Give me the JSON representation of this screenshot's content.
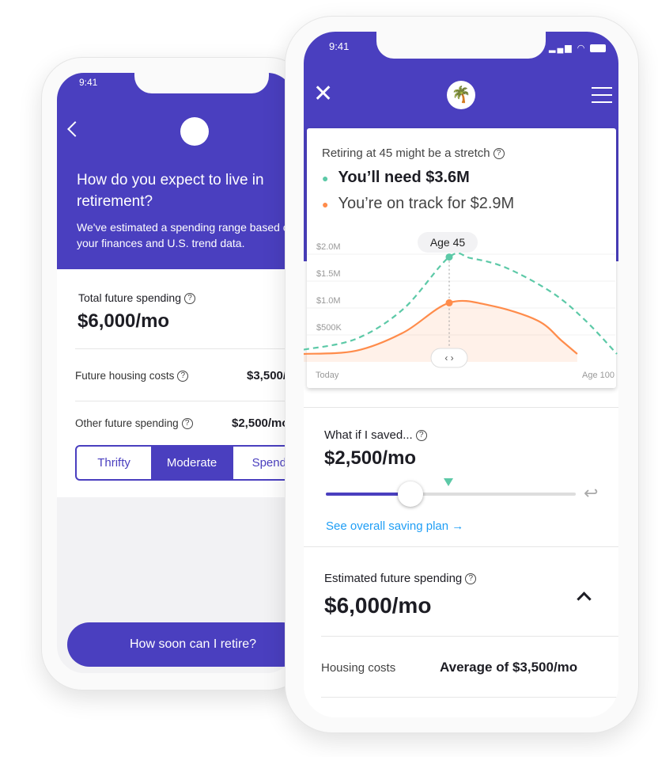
{
  "colors": {
    "brand": "#4a3fbf",
    "need": "#5cc9a7",
    "on_track": "#ff8c4b",
    "link": "#1f9ef5"
  },
  "back_phone": {
    "status_time": "9:41",
    "back_icon": "chevron-left-icon",
    "title": "How do you expect to live in retirement?",
    "subtitle": "We've estimated a spending range based on your finances and U.S. trend data.",
    "total_label": "Total future spending",
    "total_value": "$6,000/mo",
    "housing_label": "Future housing costs",
    "housing_value": "$3,500/mo",
    "other_label": "Other future spending",
    "other_value": "$2,500/mo",
    "segments": [
      "Thrifty",
      "Moderate",
      "Spendy"
    ],
    "selected_segment": "Moderate",
    "cta": "How soon can I retire?"
  },
  "front_phone": {
    "status_time": "9:41",
    "close_icon": "close-icon",
    "logo_icon": "palm-tree-icon",
    "menu_icon": "hamburger-menu-icon",
    "card": {
      "headline": "Retiring at 45 might be a stretch",
      "need": "You’ll need $3.6M",
      "on_track": "You’re on track for $2.9M"
    },
    "saving": {
      "label": "What if I saved...",
      "value": "$2,500/mo",
      "slider_fraction": 0.34,
      "target_fraction": 0.49,
      "link": "See overall saving plan →"
    },
    "spending": {
      "label": "Estimated future spending",
      "value": "$6,000/mo",
      "housing_label": "Housing costs",
      "housing_value": "Average of $3,500/mo"
    }
  },
  "chart_data": {
    "type": "line",
    "tooltip": "Age 45",
    "x_labels": [
      "Today",
      "Age 100"
    ],
    "y_ticks": [
      "$500K",
      "$1.0M",
      "$1.5M",
      "$2.0M"
    ],
    "y_tick_values": [
      0.5,
      1.0,
      1.5,
      2.0
    ],
    "ylim": [
      0,
      2.0
    ],
    "x_unit": "age",
    "y_unit": "$M",
    "marker_x": 45,
    "series": [
      {
        "key": "need",
        "style": "dashed",
        "points": [
          [
            30,
            0.08
          ],
          [
            35.4,
            0.28
          ],
          [
            40.3,
            0.84
          ],
          [
            45,
            1.8
          ],
          [
            52,
            1.78
          ],
          [
            63.7,
            1.6
          ],
          [
            79,
            1.13
          ],
          [
            89.7,
            0.62
          ],
          [
            100,
            0.0
          ]
        ]
      },
      {
        "key": "on_track",
        "style": "solid-filled",
        "points": [
          [
            30,
            0.0
          ],
          [
            35.4,
            0.06
          ],
          [
            40.3,
            0.4
          ],
          [
            45,
            0.95
          ],
          [
            58.5,
            0.9
          ],
          [
            74,
            0.62
          ],
          [
            81.8,
            0.25
          ],
          [
            87,
            0.0
          ]
        ]
      }
    ]
  }
}
